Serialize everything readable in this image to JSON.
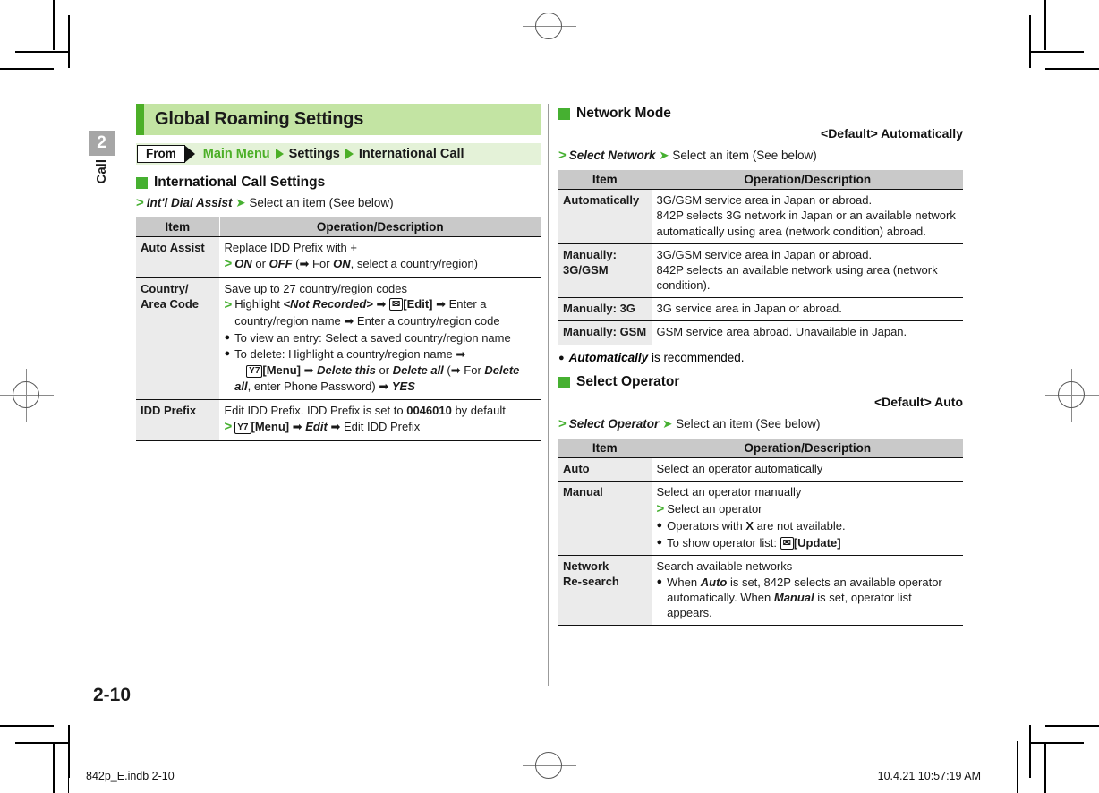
{
  "page": {
    "chapter_number": "2",
    "chapter_label": "Call",
    "page_number": "2-10",
    "footer_left": "842p_E.indb   2-10",
    "footer_right": "10.4.21   10:57:19 AM"
  },
  "colors": {
    "title_bar_bg": "#c3e4a3",
    "title_accent": "#4caf27",
    "breadcrumb_bg": "#e4f2d8",
    "green": "#46b031",
    "table_header_bg": "#c9c9c9",
    "table_item_bg": "#ebebeb",
    "tab_bg": "#a6a6a6"
  },
  "left": {
    "title": "Global Roaming Settings",
    "from_label": "From",
    "breadcrumb": [
      {
        "text": "Main Menu",
        "green": true
      },
      {
        "text": "Settings",
        "green": false
      },
      {
        "text": "International Call",
        "green": false
      }
    ],
    "section": {
      "heading": "International Call Settings",
      "step": {
        "bold_italic": "Int'l Dial Assist",
        "rest": "Select an item (See below)"
      }
    },
    "table": {
      "headers": [
        "Item",
        "Operation/Description"
      ],
      "rows": [
        {
          "item": "Auto Assist",
          "lines": [
            "Replace IDD Prefix with +",
            "ON or OFF ( For ON, select a country/region)"
          ]
        },
        {
          "item": "Country/\nArea Code",
          "lines": [
            "Save up to 27 country/region codes",
            "Highlight <Not Recorded>  [Edit]  Enter a country/region name  Enter a country/region code",
            "To view an entry: Select a saved country/region name",
            "To delete: Highlight a country/region name  [Menu]  Delete this or Delete all ( For Delete all, enter Phone Password)  YES"
          ]
        },
        {
          "item": "IDD Prefix",
          "lines": [
            "Edit IDD Prefix. IDD Prefix is set to 0046010 by default",
            "[Menu]  Edit  Edit IDD Prefix"
          ]
        }
      ]
    }
  },
  "right": {
    "network_mode": {
      "heading": "Network Mode",
      "default_note": "<Default> Automatically",
      "step": {
        "bold_italic": "Select Network",
        "rest": "Select an item (See below)"
      },
      "table": {
        "headers": [
          "Item",
          "Operation/Description"
        ],
        "rows": [
          {
            "item": "Automatically",
            "lines": [
              "3G/GSM service area in Japan or abroad.",
              "842P selects 3G network in Japan or an available network automatically using area (network condition) abroad."
            ]
          },
          {
            "item": "Manually:\n3G/GSM",
            "lines": [
              "3G/GSM service area in Japan or abroad.",
              "842P selects an available network using area (network condition)."
            ]
          },
          {
            "item": "Manually: 3G",
            "lines": [
              "3G service area in Japan or abroad."
            ]
          },
          {
            "item": "Manually: GSM",
            "lines": [
              "GSM service area abroad. Unavailable in Japan."
            ]
          }
        ]
      },
      "note": {
        "bold_italic": "Automatically",
        "rest": " is recommended."
      }
    },
    "select_operator": {
      "heading": "Select Operator",
      "default_note": "<Default> Auto",
      "step": {
        "bold_italic": "Select Operator",
        "rest": "Select an item (See below)"
      },
      "table": {
        "headers": [
          "Item",
          "Operation/Description"
        ],
        "rows": [
          {
            "item": "Auto",
            "lines": [
              "Select an operator automatically"
            ]
          },
          {
            "item": "Manual",
            "lines": [
              "Select an operator manually",
              "Select an operator",
              "Operators with X are not available.",
              "To show operator list: [Update]"
            ]
          },
          {
            "item": "Network\nRe-search",
            "lines": [
              "Search available networks",
              "When Auto is set, 842P selects an available operator automatically. When Manual is set, operator list appears."
            ]
          }
        ]
      }
    }
  },
  "icons": {
    "mail_key": "envelope-key-icon",
    "menu_key": "menu-key-icon",
    "registration_mark": "registration-mark-icon",
    "crop_mark": "crop-mark-icon"
  }
}
